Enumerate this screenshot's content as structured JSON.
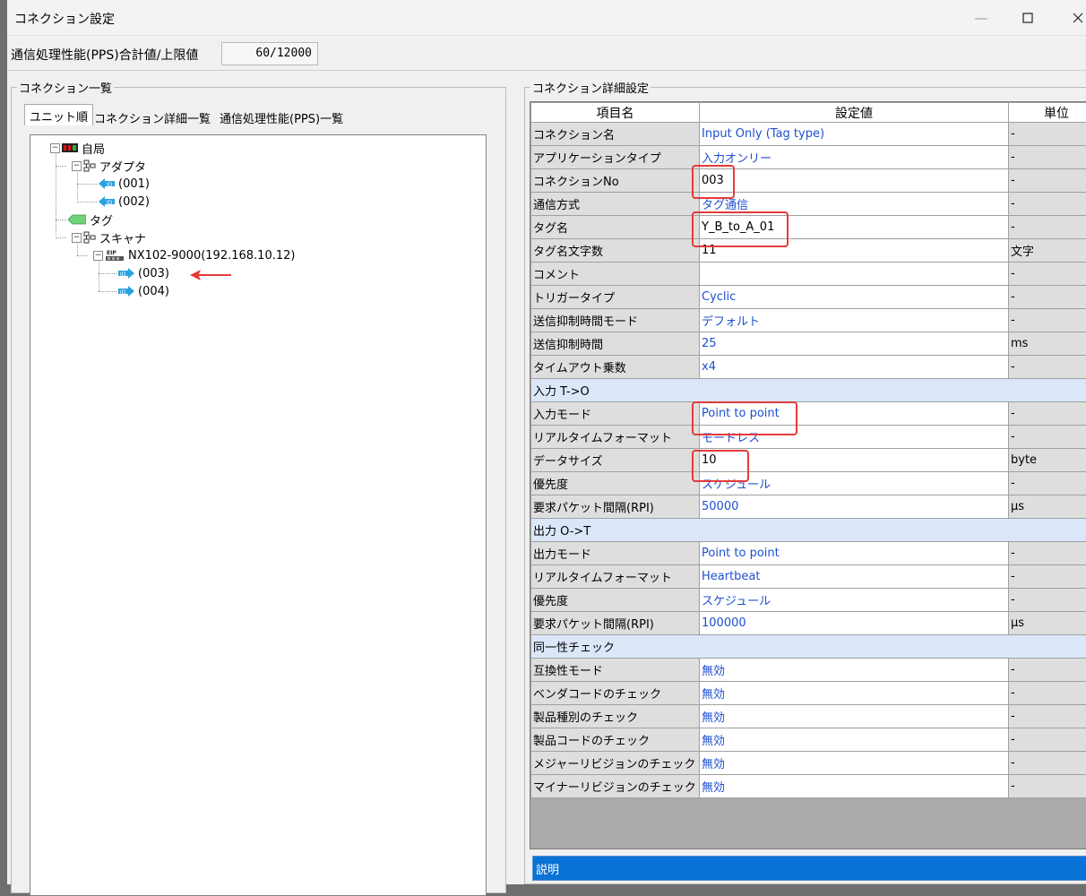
{
  "window": {
    "title": "コネクション設定",
    "minimize_glyph": "—",
    "maximize_glyph": "☐",
    "close_glyph": "✕"
  },
  "pps": {
    "label": "通信処理性能(PPS)合計値/上限値",
    "value": "60/12000"
  },
  "left_panel": {
    "title": "コネクション一覧",
    "tabs": [
      "ユニット順",
      "コネクション詳細一覧",
      "通信処理性能(PPS)一覧"
    ],
    "active_tab": 0,
    "tree": {
      "root": "自局",
      "adapter": "アダプタ",
      "adapter_items": [
        "(001)",
        "(002)"
      ],
      "tag": "タグ",
      "scanner": "スキャナ",
      "device": "NX102-9000(192.168.10.12)",
      "device_items": [
        "(003)",
        "(004)"
      ],
      "device_badge": "EIP"
    }
  },
  "right_panel": {
    "title": "コネクション詳細設定",
    "headers": {
      "name": "項目名",
      "value": "設定値",
      "unit": "単位"
    },
    "rows": [
      {
        "type": "row",
        "name": "コネクション名",
        "value": "Input Only (Tag type)",
        "unit": "-",
        "blue": true
      },
      {
        "type": "row",
        "name": "アプリケーションタイプ",
        "value": "入力オンリー",
        "unit": "-",
        "blue": true
      },
      {
        "type": "row",
        "name": "コネクションNo",
        "value": "003",
        "unit": "-",
        "blue": false
      },
      {
        "type": "row",
        "name": "通信方式",
        "value": "タグ通信",
        "unit": "-",
        "blue": true
      },
      {
        "type": "row",
        "name": "タグ名",
        "value": "Y_B_to_A_01",
        "unit": "-",
        "blue": false
      },
      {
        "type": "row",
        "name": "タグ名文字数",
        "value": "11",
        "unit": "文字",
        "blue": false
      },
      {
        "type": "row",
        "name": "コメント",
        "value": "",
        "unit": "-",
        "blue": false
      },
      {
        "type": "row",
        "name": "トリガータイプ",
        "value": "Cyclic",
        "unit": "-",
        "blue": true
      },
      {
        "type": "row",
        "name": "送信抑制時間モード",
        "value": "デフォルト",
        "unit": "-",
        "blue": true
      },
      {
        "type": "row",
        "name": "送信抑制時間",
        "value": "25",
        "unit": "ms",
        "blue": true
      },
      {
        "type": "row",
        "name": "タイムアウト乗数",
        "value": "x4",
        "unit": "-",
        "blue": true
      },
      {
        "type": "section",
        "name": "入力 T->O"
      },
      {
        "type": "row",
        "name": "入力モード",
        "value": "Point to point",
        "unit": "-",
        "blue": true
      },
      {
        "type": "row",
        "name": "リアルタイムフォーマット",
        "value": "モードレス",
        "unit": "-",
        "blue": true
      },
      {
        "type": "row",
        "name": "データサイズ",
        "value": "10",
        "unit": "byte",
        "blue": false
      },
      {
        "type": "row",
        "name": "優先度",
        "value": "スケジュール",
        "unit": "-",
        "blue": true
      },
      {
        "type": "row",
        "name": "要求パケット間隔(RPI)",
        "value": "50000",
        "unit": "µs",
        "blue": true
      },
      {
        "type": "section",
        "name": "出力 O->T"
      },
      {
        "type": "row",
        "name": "出力モード",
        "value": "Point to point",
        "unit": "-",
        "blue": true
      },
      {
        "type": "row",
        "name": "リアルタイムフォーマット",
        "value": "Heartbeat",
        "unit": "-",
        "blue": true
      },
      {
        "type": "row",
        "name": "優先度",
        "value": "スケジュール",
        "unit": "-",
        "blue": true
      },
      {
        "type": "row",
        "name": "要求パケット間隔(RPI)",
        "value": "100000",
        "unit": "µs",
        "blue": true
      },
      {
        "type": "section",
        "name": "同一性チェック"
      },
      {
        "type": "row",
        "name": "互換性モード",
        "value": "無効",
        "unit": "-",
        "blue": true
      },
      {
        "type": "row",
        "name": "ベンダコードのチェック",
        "value": "無効",
        "unit": "-",
        "blue": true
      },
      {
        "type": "row",
        "name": "製品種別のチェック",
        "value": "無効",
        "unit": "-",
        "blue": true
      },
      {
        "type": "row",
        "name": "製品コードのチェック",
        "value": "無効",
        "unit": "-",
        "blue": true
      },
      {
        "type": "row",
        "name": "メジャーリビジョンのチェック",
        "value": "無効",
        "unit": "-",
        "blue": true
      },
      {
        "type": "row",
        "name": "マイナーリビジョンのチェック",
        "value": "無効",
        "unit": "-",
        "blue": true
      }
    ],
    "description_label": "説明"
  },
  "annotations": {
    "highlight_color": "#e53a3a"
  }
}
